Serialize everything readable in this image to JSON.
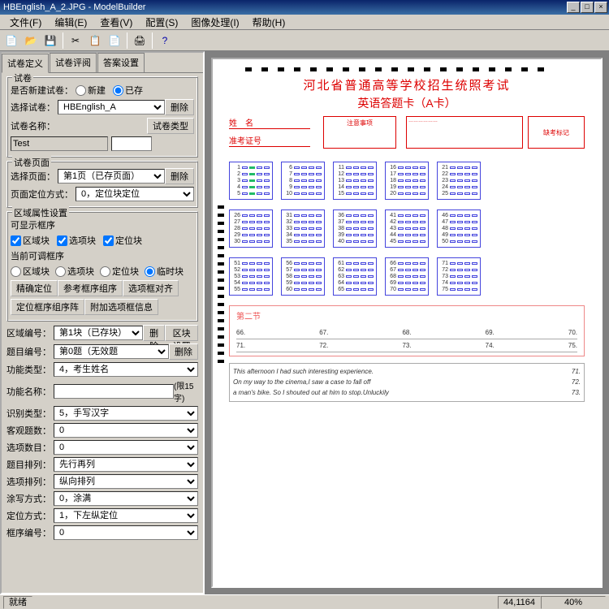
{
  "titlebar": {
    "text": "HBEnglish_A_2.JPG - ModelBuilder"
  },
  "menu": {
    "file": "文件(F)",
    "edit": "编辑(E)",
    "view": "查看(V)",
    "config": "配置(S)",
    "image": "图像处理(I)",
    "help": "帮助(H)"
  },
  "tabs": {
    "define": "试卷定义",
    "review": "试卷评阅",
    "answer": "答案设置"
  },
  "panel": {
    "paper": {
      "title": "试卷",
      "new_label": "是否新建试卷：",
      "radio_new": "新建",
      "radio_exist": "已存",
      "select_label": "选择试卷：",
      "select_value": "HBEnglish_A",
      "del": "删除",
      "name_label": "试卷名称：",
      "name_value": "Test",
      "type_btn": "试卷类型"
    },
    "page": {
      "title": "试卷页面",
      "page_label": "选择页面：",
      "page_value": "第1页（已存页面）",
      "del": "删除",
      "anchor_label": "页面定位方式：",
      "anchor_value": "0，定位块定位"
    },
    "region": {
      "title": "区域属性设置",
      "show_frame": "可显示框序",
      "chk_region": "区域块",
      "chk_option": "选项块",
      "chk_locate": "定位块",
      "adjust": "当前可调框序",
      "r_region": "区域块",
      "r_option": "选项块",
      "r_locate": "定位块",
      "r_temp": "临时块",
      "btn_precise": "精确定位",
      "btn_ref": "参考框序组序",
      "btn_align": "选项框对齐",
      "btn_locate_arr": "定位框序组序阵",
      "btn_append": "附加选项框信息"
    },
    "props": {
      "block_label": "区域编号：",
      "block_value": "第1块（已存块）",
      "block_del": "删除",
      "block_set": "区块设置",
      "topic_label": "题目编号：",
      "topic_value": "第0题（无效题",
      "topic_del": "删除",
      "func_type_label": "功能类型：",
      "func_type_value": "4，考生姓名",
      "func_name_label": "功能名称：",
      "func_name_hint": "(限15字)",
      "rec_type_label": "识别类型：",
      "rec_type_value": "5，手写汉字",
      "obj_count_label": "客观题数：",
      "obj_count_value": "0",
      "opt_count_label": "选项数目：",
      "opt_count_value": "0",
      "topic_arr_label": "题目排列：",
      "topic_arr_value": "先行再列",
      "opt_arr_label": "选项排列：",
      "opt_arr_value": "纵向排列",
      "paint_label": "涂写方式：",
      "paint_value": "0，涂满",
      "locate_label": "定位方式：",
      "locate_value": "1，下左纵定位",
      "frame_label": "框序编号：",
      "frame_value": "0"
    }
  },
  "sheet": {
    "title": "河北省普通高等学校招生统照考试",
    "subtitle": "英语答题卡（A卡）",
    "name_label": "姓　名",
    "exam_no": "准考证号",
    "barcode_label": "注意事项",
    "absent_label": "缺考标记",
    "section2": "第二节",
    "fill_nums": [
      "66.",
      "67.",
      "68.",
      "69.",
      "70."
    ],
    "fill_nums2": [
      "71.",
      "72.",
      "73.",
      "74.",
      "75."
    ],
    "essay": {
      "l1": "This afternoon I had such interesting experience.",
      "l2": "On my way to the cinema,I saw a case to fall off",
      "l3": "a man's bike. So I shouted out at him to stop.Unluckily"
    },
    "essay_nums": [
      "71.",
      "72.",
      "73."
    ]
  },
  "status": {
    "ready": "就绪",
    "coords": "44,1164",
    "zoom": "40%"
  }
}
